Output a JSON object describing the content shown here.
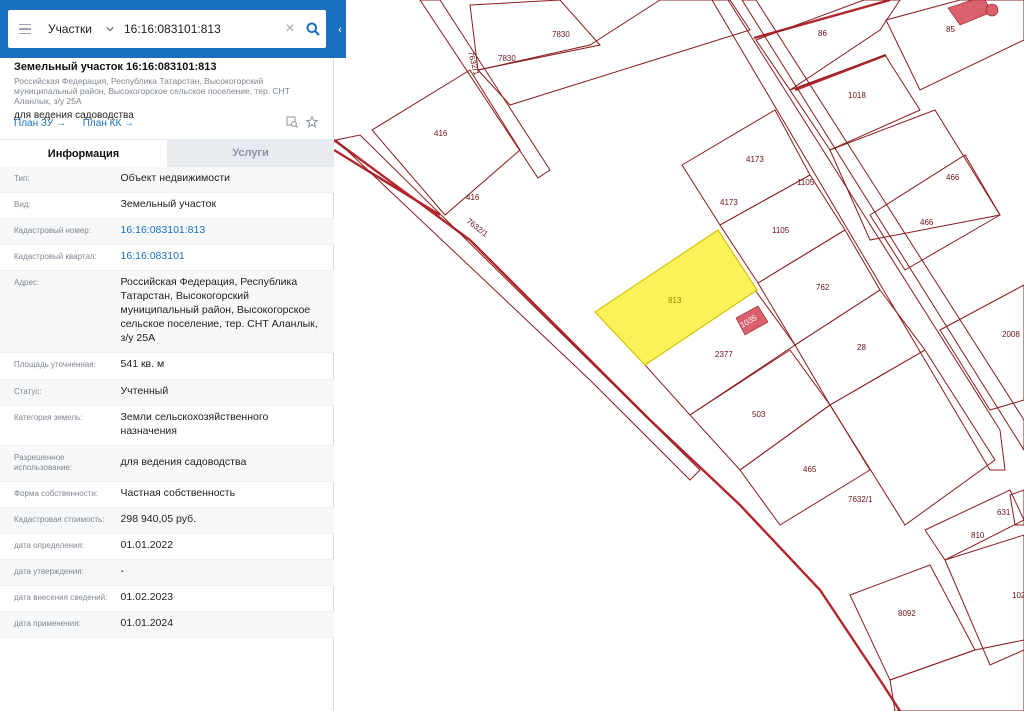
{
  "search": {
    "category": "Участки",
    "query": "16:16:083101:813"
  },
  "object": {
    "title": "Земельный участок 16:16:083101:813",
    "address_short": "Российская Федерация, Республика Татарстан, Высокогорский муниципальный район, Высокогорское сельское поселение, тер. СНТ Аланлык, з/у 25А",
    "permitted_use": "для ведения садоводства",
    "link_plan_zu": "План ЗУ →",
    "link_plan_kk": "План КК →"
  },
  "tabs": [
    "Информация",
    "Услуги"
  ],
  "properties": [
    {
      "key": "Тип:",
      "value": "Объект недвижимости"
    },
    {
      "key": "Вид:",
      "value": "Земельный участок"
    },
    {
      "key": "Кадастровый номер:",
      "value": "16:16:083101:813"
    },
    {
      "key": "Кадастровый квартал:",
      "value": "16:16:083101"
    },
    {
      "key": "Адрес:",
      "value": "Российская Федерация, Республика Татарстан, Высокогорский муниципальный район, Высокогорское сельское поселение, тер. СНТ Аланлык, з/у 25А"
    },
    {
      "key": "Площадь уточненная:",
      "value": "541 кв. м"
    },
    {
      "key": "Статус:",
      "value": "Учтенный"
    },
    {
      "key": "Категория земель:",
      "value": "Земли сельскохозяйственного назначения"
    },
    {
      "key": "Разрешенное использование:",
      "value": "для ведения садоводства"
    },
    {
      "key": "Форма собственности:",
      "value": "Частная собственность"
    },
    {
      "key": "Кадастровая стоимость:",
      "value": "298 940,05 руб."
    },
    {
      "key": "дата определения:",
      "value": "01.01.2022"
    },
    {
      "key": "дата утверждения:",
      "value": "-"
    },
    {
      "key": "дата внесения сведений:",
      "value": "01.02.2023"
    },
    {
      "key": "дата применения:",
      "value": "01.01.2024"
    }
  ],
  "map": {
    "labels": {
      "p7830a": "7830",
      "p7830b": "7830",
      "p86": "86",
      "p85": "85",
      "p1018": "1018",
      "road7632_1a": "7632/1",
      "p416a": "416",
      "p416b": "416",
      "road7632_1b": "7632/1",
      "p4173a": "4173",
      "p4173b": "4173",
      "p1105a": "1105",
      "p1105b": "1105",
      "p466a": "466",
      "p466b": "466",
      "p813": "813",
      "p1035": "1035",
      "p762": "762",
      "p2377": "2377",
      "p28": "28",
      "p2008": "2008",
      "p503": "503",
      "p465": "465",
      "road7632_1c": "7632/1",
      "p631": "631",
      "p810": "810",
      "p8092": "8092",
      "p102": "102"
    },
    "highlight_color": "#fbf25a",
    "parcel_stroke": "#8c1c1c",
    "building_color": "#d9606c"
  }
}
